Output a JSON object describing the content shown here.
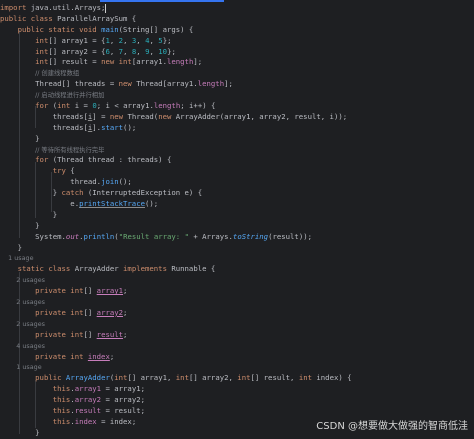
{
  "code": {
    "l1": {
      "a": "import java.util.Arrays;"
    },
    "l2": {
      "k1": "public class ",
      "a": "ParallelArraySum {"
    },
    "l3": {
      "k1": "public static void ",
      "fn": "main",
      "a": "(String[] args) {"
    },
    "l4": {
      "k1": "int",
      "a": "[] array1 = {",
      "n1": "1",
      "c1": ", ",
      "n2": "2",
      "c2": ", ",
      "n3": "3",
      "c3": ", ",
      "n4": "4",
      "c4": ", ",
      "n5": "5",
      "e": "};"
    },
    "l5": {
      "k1": "int",
      "a": "[] array2 = {",
      "n1": "6",
      "c1": ", ",
      "n2": "7",
      "c2": ", ",
      "n3": "8",
      "c3": ", ",
      "n4": "9",
      "c4": ", ",
      "n5": "10",
      "e": "};"
    },
    "l6": {
      "k1": "int",
      "a": "[] result = ",
      "k2": "new int",
      "b": "[array1.",
      "f": "length",
      "e": "];"
    },
    "l7": {
      "cm": "// 创建线程数组"
    },
    "l8": {
      "a": "Thread[] threads = ",
      "k1": "new ",
      "b": "Thread[array1.",
      "f": "length",
      "e": "];"
    },
    "l9": {
      "cm": "// 启动线程进行并行相加"
    },
    "l10": {
      "k1": "for ",
      "a": "(",
      "k2": "int ",
      "v": "i",
      "b": " = ",
      "n": "0",
      "c": "; ",
      "v2": "i",
      "d": " < array1.",
      "f": "length",
      "g": "; ",
      "v3": "i",
      "e": "++) {"
    },
    "l11": {
      "a": "threads[",
      "v": "i",
      "b": "] = ",
      "k1": "new ",
      "c": "Thread(",
      "k2": "new ",
      "d": "ArrayAdder(array1, array2, result, ",
      "v2": "i",
      "e": "));"
    },
    "l12": {
      "a": "threads[",
      "v": "i",
      "b": "].",
      "fn": "start",
      "e": "();"
    },
    "l13": {
      "a": "}"
    },
    "l14": {
      "cm": "// 等待所有线程执行完毕"
    },
    "l15": {
      "k1": "for ",
      "a": "(Thread thread : threads) {"
    },
    "l16": {
      "k1": "try ",
      "a": "{"
    },
    "l17": {
      "a": "thread.",
      "fn": "join",
      "e": "();"
    },
    "l18": {
      "a": "} ",
      "k1": "catch ",
      "b": "(InterruptedException e) {"
    },
    "l19": {
      "a": "e.",
      "fn": "printStackTrace",
      "e": "();"
    },
    "l20": {
      "a": "}"
    },
    "l21": {
      "a": "}"
    },
    "l22": {
      "a": "System.",
      "f": "out",
      "b": ".",
      "fn": "println",
      "c": "(",
      "s": "\"Result array: \"",
      "d": " + Arrays.",
      "fn2": "toString",
      "e": "(result));"
    },
    "l23": {
      "a": "}"
    },
    "l24": {
      "u": "1 usage"
    },
    "l25": {
      "k1": "static class ",
      "a": "ArrayAdder ",
      "k2": "implements ",
      "b": "Runnable {"
    },
    "l26": {
      "u": "2 usages"
    },
    "l27": {
      "k1": "private int",
      "a": "[] ",
      "f": "array1",
      "e": ";"
    },
    "l28": {
      "u": "2 usages"
    },
    "l29": {
      "k1": "private int",
      "a": "[] ",
      "f": "array2",
      "e": ";"
    },
    "l30": {
      "u": "2 usages"
    },
    "l31": {
      "k1": "private int",
      "a": "[] ",
      "f": "result",
      "e": ";"
    },
    "l32": {
      "u": "4 usages"
    },
    "l33": {
      "k1": "private int ",
      "f": "index",
      "e": ";"
    },
    "l34": {
      "u": "1 usage"
    },
    "l35": {
      "k1": "public ",
      "fn": "ArrayAdder",
      "a": "(",
      "k2": "int",
      "b": "[] array1, ",
      "k3": "int",
      "c": "[] array2, ",
      "k4": "int",
      "d": "[] result, ",
      "k5": "int ",
      "e": "index) {"
    },
    "l36": {
      "k1": "this",
      "a": ".",
      "f": "array1",
      "e": " = array1;"
    },
    "l37": {
      "k1": "this",
      "a": ".",
      "f": "array2",
      "e": " = array2;"
    },
    "l38": {
      "k1": "this",
      "a": ".",
      "f": "result",
      "e": " = result;"
    },
    "l39": {
      "k1": "this",
      "a": ".",
      "f": "index",
      "e": " = index;"
    },
    "l40": {
      "a": "}"
    }
  },
  "watermark": "CSDN @想要做大做强的智商低洼",
  "colors": {
    "background": "#1e1f22",
    "keyword": "#cf8e6d",
    "method": "#56a8f5",
    "number": "#2aacb8",
    "string": "#6aab73",
    "comment": "#7a7e85",
    "field": "#c77dbb",
    "text": "#bcbec4",
    "accent": "#3574f0"
  }
}
